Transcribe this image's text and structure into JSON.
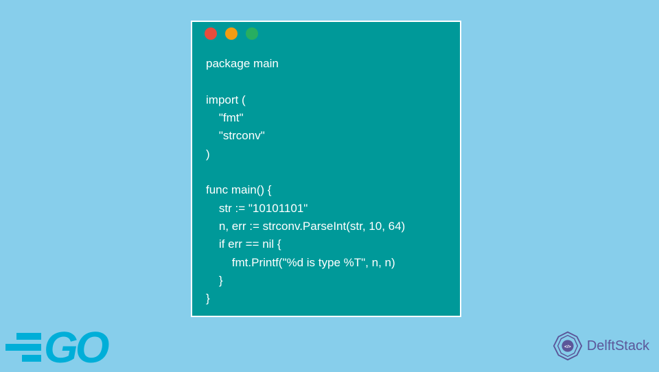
{
  "window": {
    "dot_colors": {
      "red": "#e74c3c",
      "yellow": "#f39c12",
      "green": "#27ae60"
    }
  },
  "code": {
    "line1": "package main",
    "line2": "",
    "line3": "import (",
    "line4": "    \"fmt\"",
    "line5": "    \"strconv\"",
    "line6": ")",
    "line7": "",
    "line8": "func main() {",
    "line9": "    str := \"10101101\"",
    "line10": "    n, err := strconv.ParseInt(str, 10, 64)",
    "line11": "    if err == nil {",
    "line12": "        fmt.Printf(\"%d is type %T\", n, n)",
    "line13": "    }",
    "line14": "}"
  },
  "logos": {
    "go_text": "GO",
    "delft_text": "DelftStack"
  }
}
